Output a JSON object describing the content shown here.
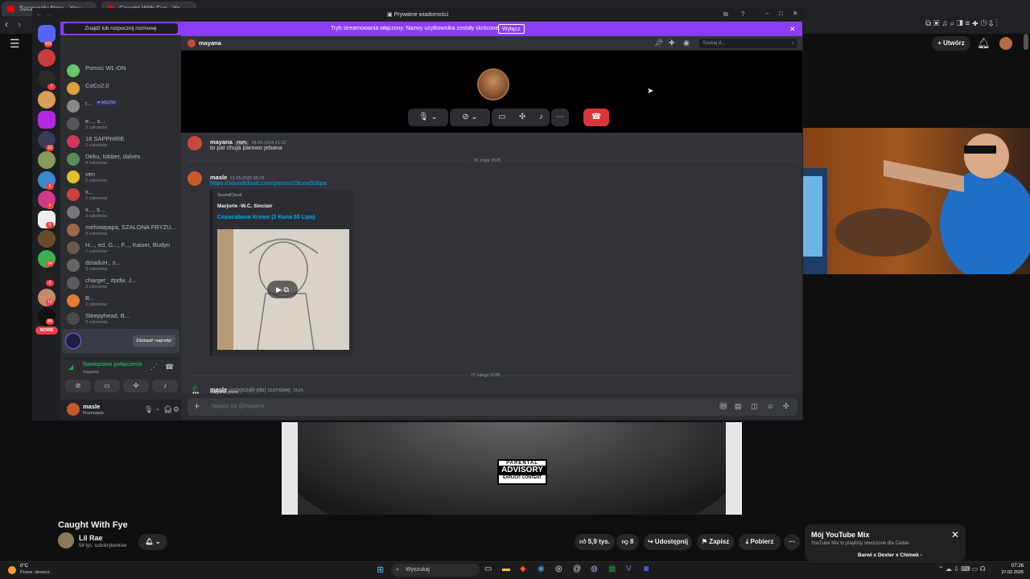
{
  "browser": {
    "tabs": [
      "Szczegóły filmu - YouTube Studio",
      "Caught With Fye - YouTube"
    ]
  },
  "youtube": {
    "create_label": "Utwórz",
    "video_title": "Caught With Fye",
    "channel": "Lil Rae",
    "subscribers": "58 tys. subskrybentów",
    "likes": "5,9 tys.",
    "dislikes": "8",
    "share": "Udostępnij",
    "save": "Zapisz",
    "download": "Pobierz",
    "mix_title": "Mój YouTube Mix",
    "mix_sub": "YouTube Mix to playlisty stworzone dla Ciebie",
    "mix_item": "Barwi x Dexter x Chimek -",
    "advisory_top": "PARENTAL",
    "advisory_mid": "ADVISORY",
    "advisory_bot": "EXPLICIT CONTENT"
  },
  "discord": {
    "window_title": "Prywatne wiadomości",
    "banner_text": "Tryb streamowania włączony. Nazwy użytkownika zostały skrócone.",
    "banner_button": "Wyłącz",
    "find_conv": "Znajdź lub rozpocznij rozmowę",
    "channel_name": "mayana",
    "search_placeholder": "Szukaj d...",
    "guild_badges": [
      "409",
      "7",
      "10",
      "6",
      "6",
      "6",
      "64",
      "6",
      "10",
      "84"
    ],
    "new_label": "NOWE",
    "dms": [
      {
        "name": "Pomoc WL-ON",
        "sub": ""
      },
      {
        "name": "CoCo2.0",
        "sub": ""
      },
      {
        "name": "r...",
        "sub": "",
        "tag": "MEOW"
      },
      {
        "name": "e..., s...",
        "sub": "3 członków"
      },
      {
        "name": "18 SAPPHIRE",
        "sub": "2 członków"
      },
      {
        "name": "Deku, tobber, dalves",
        "sub": "4 członków"
      },
      {
        "name": "ven",
        "sub": "2 członków"
      },
      {
        "name": "x...",
        "sub": "2 członków"
      },
      {
        "name": "x..., s...",
        "sub": "3 członków"
      },
      {
        "name": "mehowpapa, SZALONA FRYZU...",
        "sub": "3 członków"
      },
      {
        "name": "H..., ed, G..., F..., Kaiser, Budyn",
        "sub": "7 członków"
      },
      {
        "name": "dziaduH., z...",
        "sub": "3 członków"
      },
      {
        "name": "charger_ #pdw, J...",
        "sub": "3 członków"
      },
      {
        "name": "B...",
        "sub": "2 członków"
      },
      {
        "name": "Sleepyhead, B...",
        "sub": "3 członków"
      }
    ],
    "promo_button": "Zdobądź nagrodę!",
    "voice_status": "Nawiązano połączenie",
    "voice_user": "mayana",
    "me_name": "masle",
    "me_status": "Rozmawia",
    "messages": [
      {
        "author": "mayana",
        "tag": "HSPL",
        "time": "04.04.2024 21:12",
        "text": "to pal chuja parowo jebana"
      },
      {
        "author": "masle",
        "time": "31.05.2025 05:13",
        "text": "https://soundcloud.com/petxmr/2kuna50lipa"
      }
    ],
    "date1": "31 maja 2025",
    "date2": "27 lutego 2026",
    "embed": {
      "provider": "SoundCloud",
      "author": "Marjorie -W.C. Sinclair",
      "title": "Copacabana Kream (2 Kuna 50 Lipa)"
    },
    "call_author": "masle",
    "call_text": "rozpoczął(-ęła) rozmowę.",
    "call_time": "5h25",
    "typing_user": "mayana",
    "typing_text": "pisze...",
    "input_placeholder": "Napisz na @mayana"
  },
  "taskbar": {
    "weather_temp": "0°C",
    "weather_desc": "Przew. słonecz.",
    "search": "Wyszukaj",
    "time": "07:26",
    "date": "27.02.2026"
  }
}
